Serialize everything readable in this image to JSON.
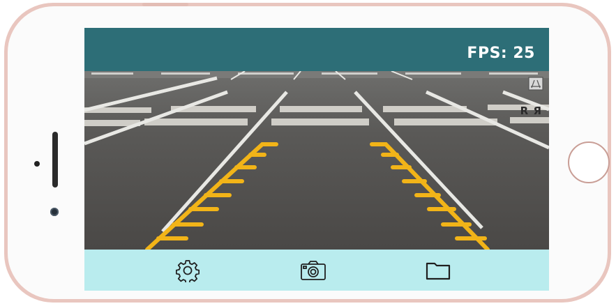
{
  "status": {
    "fps_label": "FPS: 25"
  },
  "overlay": {
    "mirror_label": "R Я",
    "guide_toggle_icon": "parking-guide-icon"
  },
  "toolbar": {
    "settings_icon": "gear-icon",
    "capture_icon": "camera-icon",
    "files_icon": "folder-icon"
  },
  "colors": {
    "topbar": "#2d6e77",
    "bottombar": "#b9ecee",
    "guide_lines": "#f2b418",
    "phone_frame": "#e9c6bf"
  }
}
